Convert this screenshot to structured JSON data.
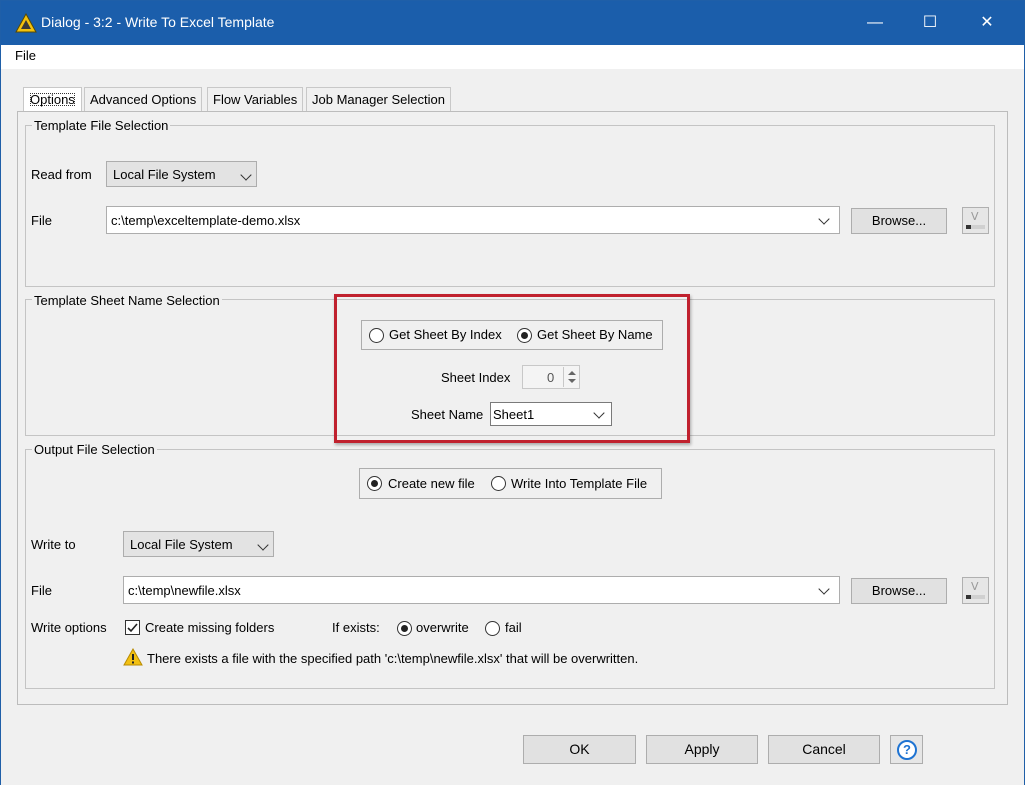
{
  "window": {
    "title": "Dialog - 3:2 - Write To Excel Template",
    "minimize": "—",
    "maximize": "☐",
    "close": "✕"
  },
  "menu": {
    "file": "File"
  },
  "tabs": [
    {
      "label": "Options",
      "active": true
    },
    {
      "label": "Advanced Options",
      "active": false
    },
    {
      "label": "Flow Variables",
      "active": false
    },
    {
      "label": "Job Manager Selection",
      "active": false
    }
  ],
  "template_file": {
    "group_label": "Template File Selection",
    "read_from_label": "Read from",
    "read_from_value": "Local File System",
    "file_label": "File",
    "file_value": "c:\\temp\\exceltemplate-demo.xlsx",
    "browse": "Browse..."
  },
  "sheet_selection": {
    "group_label": "Template Sheet Name Selection",
    "by_index_label": "Get Sheet By Index",
    "by_name_label": "Get Sheet By Name",
    "selected": "by_name",
    "sheet_index_label": "Sheet Index",
    "sheet_index_value": "0",
    "sheet_name_label": "Sheet Name",
    "sheet_name_value": "Sheet1",
    "highlight_color": "#c0212e"
  },
  "output_file": {
    "group_label": "Output File Selection",
    "create_new_label": "Create new file",
    "write_into_label": "Write Into Template File",
    "selected": "create_new",
    "write_to_label": "Write to",
    "write_to_value": "Local File System",
    "file_label": "File",
    "file_value": "c:\\temp\\newfile.xlsx",
    "browse": "Browse...",
    "write_options_label": "Write options",
    "create_missing_folders_label": "Create missing folders",
    "create_missing_folders_checked": true,
    "if_exists_label": "If exists:",
    "overwrite_label": "overwrite",
    "fail_label": "fail",
    "if_exists_selected": "overwrite",
    "warning_text": "There exists a file with the specified path 'c:\\temp\\newfile.xlsx' that will be overwritten."
  },
  "footer": {
    "ok": "OK",
    "apply": "Apply",
    "cancel": "Cancel",
    "help_icon": "?"
  },
  "colors": {
    "titlebar": "#1b5eab",
    "help": "#1e73d2",
    "warning": "#f2c012"
  }
}
